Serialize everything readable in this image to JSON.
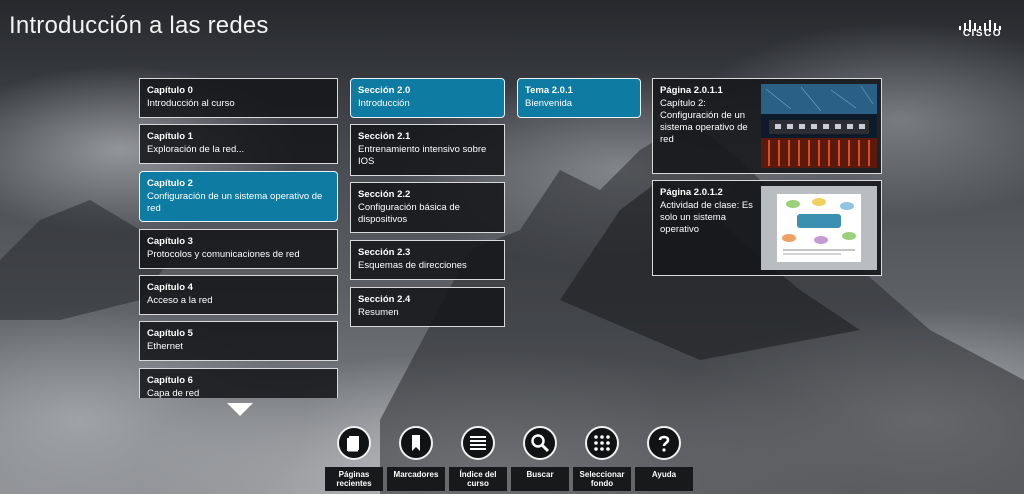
{
  "app": {
    "title": "Introducción a las redes",
    "logo_text": "CISCO"
  },
  "chapters": [
    {
      "num": "Capítulo 0",
      "name": "Introducción al curso"
    },
    {
      "num": "Capítulo 1",
      "name": "Exploración de la red..."
    },
    {
      "num": "Capítulo 2",
      "name": "Configuración de un sistema operativo de red"
    },
    {
      "num": "Capítulo 3",
      "name": "Protocolos y comunicaciones de red"
    },
    {
      "num": "Capítulo 4",
      "name": "Acceso a la red"
    },
    {
      "num": "Capítulo 5",
      "name": "Ethernet"
    },
    {
      "num": "Capítulo 6",
      "name": "Capa de red"
    }
  ],
  "sections": [
    {
      "num": "Sección 2.0",
      "name": "Introducción"
    },
    {
      "num": "Sección 2.1",
      "name": "Entrenamiento intensivo sobre IOS"
    },
    {
      "num": "Sección 2.2",
      "name": "Configuración básica de dispositivos"
    },
    {
      "num": "Sección 2.3",
      "name": "Esquemas de direcciones"
    },
    {
      "num": "Sección 2.4",
      "name": "Resumen"
    }
  ],
  "topics": [
    {
      "num": "Tema 2.0.1",
      "name": "Bienvenida"
    }
  ],
  "pages": [
    {
      "num": "Página 2.0.1.1",
      "name": "Capítulo 2: Configuración de un sistema operativo de red"
    },
    {
      "num": "Página 2.0.1.2",
      "name": "Actividad de clase: Es solo un sistema operativo"
    }
  ],
  "toolbar": [
    {
      "label": "Páginas recientes",
      "icon": "book-icon"
    },
    {
      "label": "Marcadores",
      "icon": "bookmark-icon"
    },
    {
      "label": "Índice del curso",
      "icon": "list-icon"
    },
    {
      "label": "Buscar",
      "icon": "search-icon"
    },
    {
      "label": "Seleccionar fondo",
      "icon": "grid-icon"
    },
    {
      "label": "Ayuda",
      "icon": "help-icon"
    }
  ],
  "colors": {
    "accent": "#0d7ba2",
    "card_bg": "#16171a",
    "border": "#d9d9d9"
  }
}
